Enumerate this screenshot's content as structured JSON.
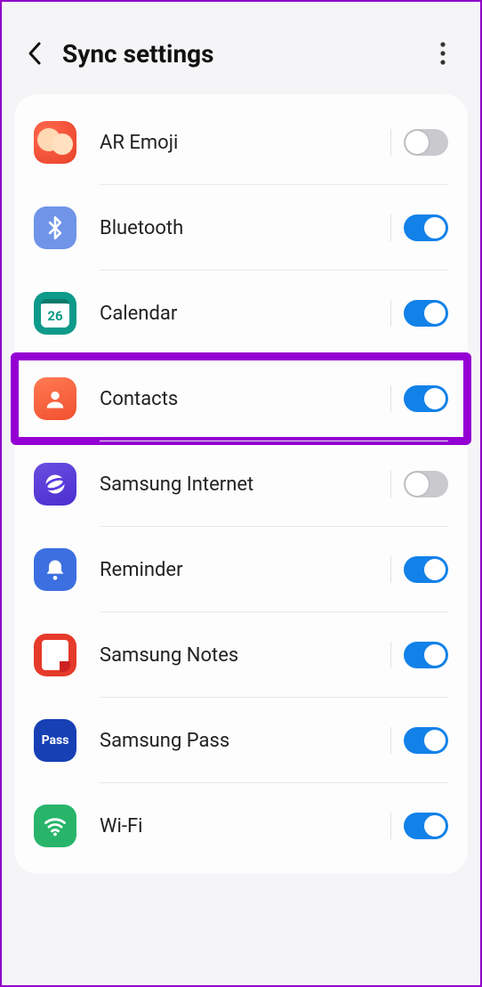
{
  "header": {
    "title": "Sync settings"
  },
  "items": [
    {
      "id": "ar-emoji",
      "label": "AR Emoji",
      "icon": "aremoji",
      "on": false,
      "highlighted": false
    },
    {
      "id": "bluetooth",
      "label": "Bluetooth",
      "icon": "bluetooth",
      "on": true,
      "highlighted": false
    },
    {
      "id": "calendar",
      "label": "Calendar",
      "icon": "calendar",
      "on": true,
      "highlighted": false,
      "calendar_day": "26"
    },
    {
      "id": "contacts",
      "label": "Contacts",
      "icon": "contacts",
      "on": true,
      "highlighted": true
    },
    {
      "id": "samsung-internet",
      "label": "Samsung Internet",
      "icon": "internet",
      "on": false,
      "highlighted": false
    },
    {
      "id": "reminder",
      "label": "Reminder",
      "icon": "reminder",
      "on": true,
      "highlighted": false
    },
    {
      "id": "samsung-notes",
      "label": "Samsung Notes",
      "icon": "notes",
      "on": true,
      "highlighted": false
    },
    {
      "id": "samsung-pass",
      "label": "Samsung Pass",
      "icon": "pass",
      "on": true,
      "highlighted": false,
      "pass_text": "Pass"
    },
    {
      "id": "wifi",
      "label": "Wi-Fi",
      "icon": "wifi",
      "on": true,
      "highlighted": false
    }
  ]
}
